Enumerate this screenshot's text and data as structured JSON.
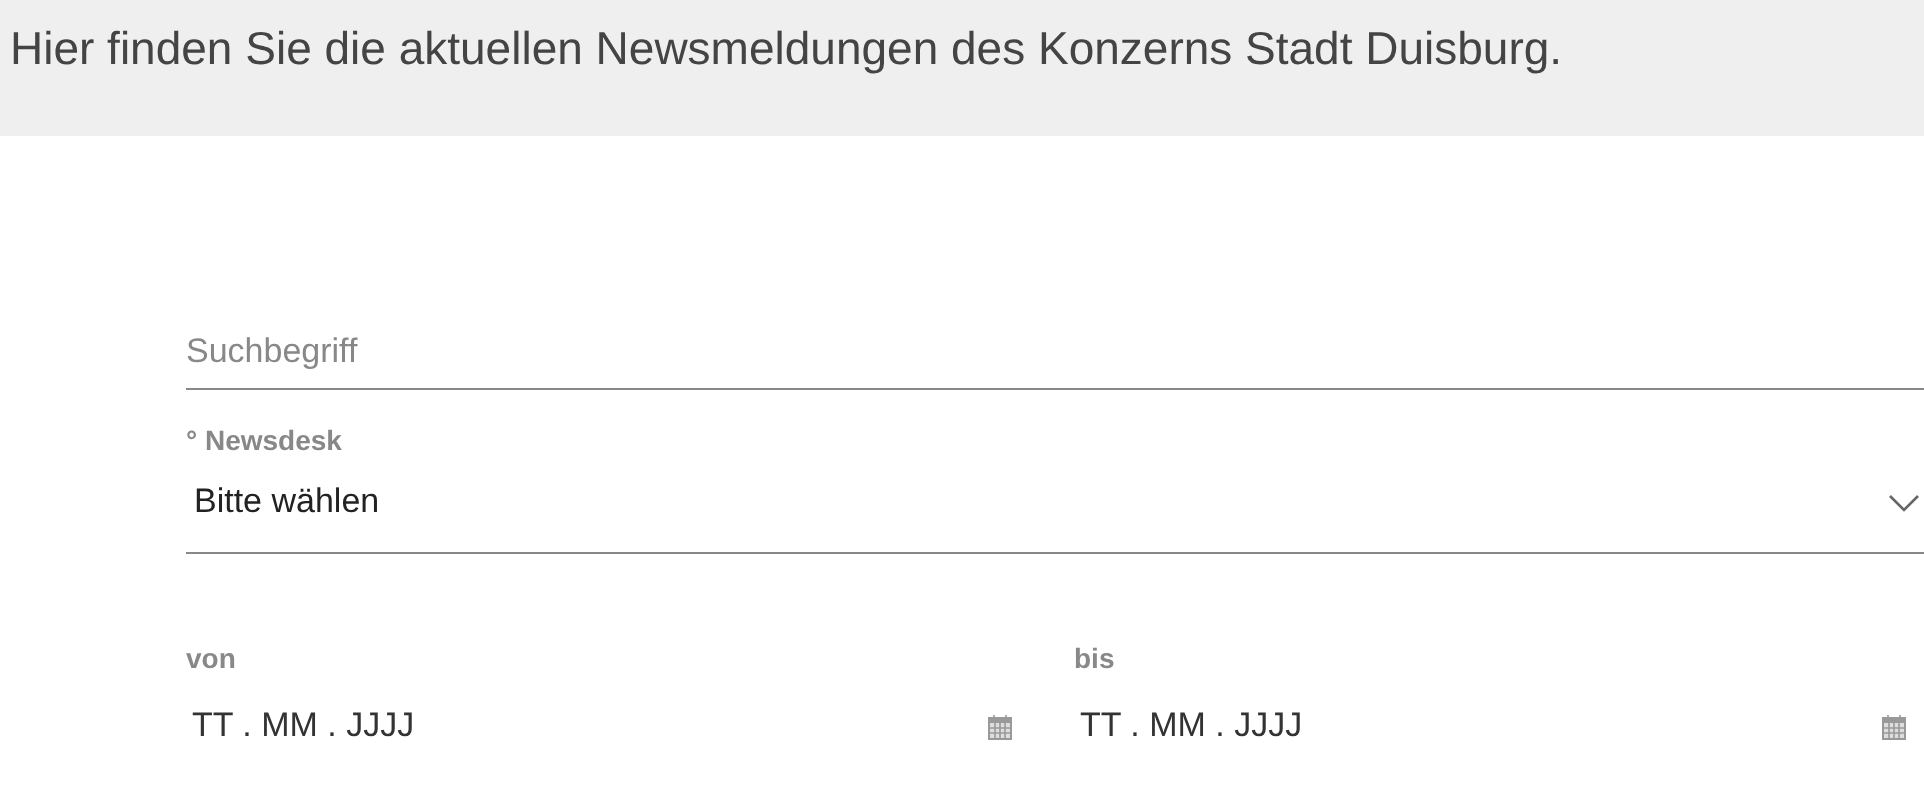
{
  "intro": "Hier finden Sie die aktuellen Newsmeldungen des Konzerns Stadt Duisburg.",
  "search": {
    "placeholder": "Suchbegriff"
  },
  "newsdesk": {
    "label": "° Newsdesk",
    "value": "Bitte wählen"
  },
  "dates": [
    {
      "label": "von",
      "value": "TT . MM . JJJJ"
    },
    {
      "label": "bis",
      "value": "TT . MM . JJJJ"
    }
  ]
}
